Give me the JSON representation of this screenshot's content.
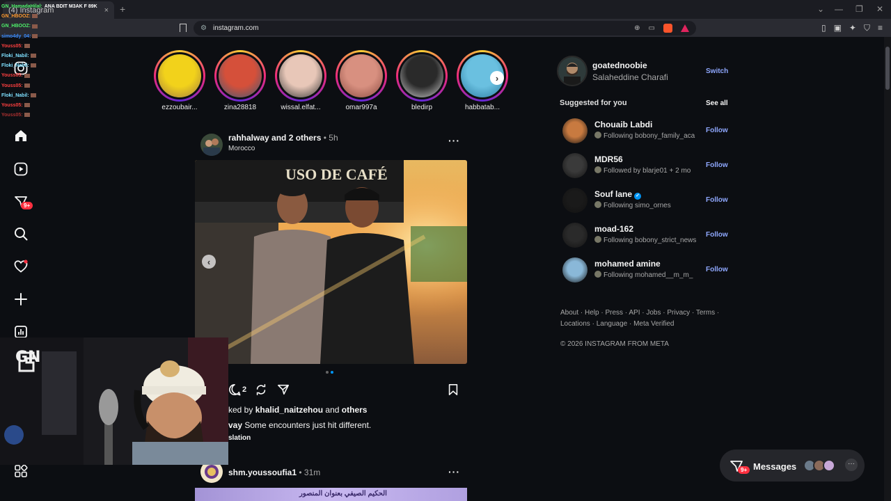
{
  "browser": {
    "tab_title": "(4) Instagram",
    "url": "instagram.com",
    "new_tab": "+",
    "tab_close": "×"
  },
  "chat": {
    "lines": [
      {
        "user": "GN_HamadaHilal:",
        "text": "ANA BDIT M3AK F 89K",
        "color": "#4ef06a"
      },
      {
        "user": "GN_HBOOZ:",
        "text": "",
        "color": "#ff9a2e"
      },
      {
        "user": "GN_HBOOZ:",
        "text": "",
        "color": "#4ef06a"
      },
      {
        "user": "simo4dy_04:",
        "text": "",
        "color": "#3a8cff"
      },
      {
        "user": "Youss05:",
        "text": "",
        "color": "#ff4040"
      },
      {
        "user": "Floki_Nabil:",
        "text": "",
        "color": "#7fe0ff"
      },
      {
        "user": "Floki_Nabil:",
        "text": "",
        "color": "#7fe0ff"
      },
      {
        "user": "Youss05:",
        "text": "",
        "color": "#ff4040"
      },
      {
        "user": "Youss05:",
        "text": "",
        "color": "#ff4040"
      },
      {
        "user": "Floki_Nabil:",
        "text": "",
        "color": "#7fe0ff"
      },
      {
        "user": "Youss05:",
        "text": "",
        "color": "#ff4040"
      },
      {
        "user": "Youss05:",
        "text": "",
        "color": "#aa3030"
      }
    ]
  },
  "nav": {
    "notifications_badge": "9+",
    "logo_text": "GN"
  },
  "stories": [
    {
      "name": "ezzoubair...",
      "colors": [
        "#f2d21b",
        "#a07a40"
      ]
    },
    {
      "name": "zina28818",
      "colors": [
        "#d5503a",
        "#3a5a7a"
      ]
    },
    {
      "name": "wissal.elfat...",
      "colors": [
        "#e8c7b8",
        "#333333"
      ]
    },
    {
      "name": "omar997a",
      "colors": [
        "#d89080",
        "#8a4a40"
      ]
    },
    {
      "name": "bledirp",
      "colors": [
        "#2a2a2a",
        "#d0d0d0"
      ]
    },
    {
      "name": "habbatab...",
      "colors": [
        "#6ac0e0",
        "#2a7aa0"
      ]
    }
  ],
  "post": {
    "user": "rahhalway",
    "and_others": "and 2 others",
    "time": "• 5h",
    "location": "Morocco",
    "comment_count": "2",
    "likes_prefix": "ked by",
    "liked_user": "khalid_naitzehou",
    "likes_and": "and",
    "likes_others": "others",
    "caption_user": "vay",
    "caption_text": "Some encounters just hit different.",
    "translation": "slation",
    "image_sign": "USO DE CAFÉ"
  },
  "post2": {
    "user": "shm.youssoufia1",
    "time": "• 31m",
    "banner_text": "الحكيم الصيفي بعنوان المنصور"
  },
  "me": {
    "username": "goatednoobie",
    "fullname": "Salaheddine Charafi",
    "switch": "Switch"
  },
  "suggestions": {
    "title": "Suggested for you",
    "see_all": "See all",
    "items": [
      {
        "user": "Chouaib Labdi",
        "sub": "Following bobony_family_aca",
        "follow": "Follow",
        "verified": false,
        "av": "#c87a40"
      },
      {
        "user": "MDR56",
        "sub": "Followed by blarje01 + 2 mo",
        "follow": "Follow",
        "verified": false,
        "av": "#3a3a3a"
      },
      {
        "user": "Souf lane",
        "sub": "Following simo_ornes",
        "follow": "Follow",
        "verified": true,
        "av": "#1a1a1a"
      },
      {
        "user": "moad-162",
        "sub": "Following bobony_strict_news",
        "follow": "Follow",
        "verified": false,
        "av": "#2a2a2a"
      },
      {
        "user": "mohamed amine",
        "sub": "Following mohamed__m_m_",
        "follow": "Follow",
        "verified": false,
        "av": "#8ab8d8"
      }
    ]
  },
  "footer": {
    "links_line1": "About · Help · Press · API · Jobs · Privacy · Terms ·",
    "links_line2": "Locations · Language · Meta Verified",
    "copyright": "© 2026 INSTAGRAM FROM META"
  },
  "messages": {
    "label": "Messages",
    "badge": "9+",
    "more": "···"
  },
  "colors": {
    "accent": "#0095f6",
    "badge": "#ff3040",
    "link": "#8fa8ff"
  }
}
